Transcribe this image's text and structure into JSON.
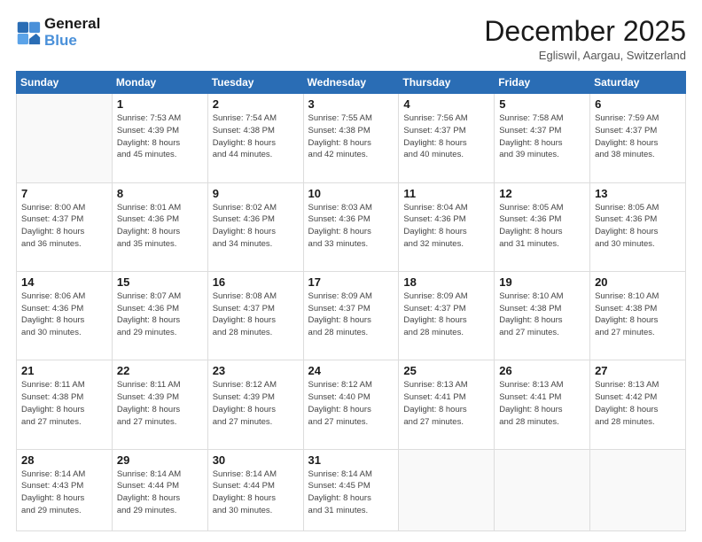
{
  "logo": {
    "line1": "General",
    "line2": "Blue"
  },
  "header": {
    "month": "December 2025",
    "location": "Egliswil, Aargau, Switzerland"
  },
  "weekdays": [
    "Sunday",
    "Monday",
    "Tuesday",
    "Wednesday",
    "Thursday",
    "Friday",
    "Saturday"
  ],
  "weeks": [
    [
      {
        "day": "",
        "sunrise": "",
        "sunset": "",
        "daylight": ""
      },
      {
        "day": "1",
        "sunrise": "Sunrise: 7:53 AM",
        "sunset": "Sunset: 4:39 PM",
        "daylight": "Daylight: 8 hours and 45 minutes."
      },
      {
        "day": "2",
        "sunrise": "Sunrise: 7:54 AM",
        "sunset": "Sunset: 4:38 PM",
        "daylight": "Daylight: 8 hours and 44 minutes."
      },
      {
        "day": "3",
        "sunrise": "Sunrise: 7:55 AM",
        "sunset": "Sunset: 4:38 PM",
        "daylight": "Daylight: 8 hours and 42 minutes."
      },
      {
        "day": "4",
        "sunrise": "Sunrise: 7:56 AM",
        "sunset": "Sunset: 4:37 PM",
        "daylight": "Daylight: 8 hours and 40 minutes."
      },
      {
        "day": "5",
        "sunrise": "Sunrise: 7:58 AM",
        "sunset": "Sunset: 4:37 PM",
        "daylight": "Daylight: 8 hours and 39 minutes."
      },
      {
        "day": "6",
        "sunrise": "Sunrise: 7:59 AM",
        "sunset": "Sunset: 4:37 PM",
        "daylight": "Daylight: 8 hours and 38 minutes."
      }
    ],
    [
      {
        "day": "7",
        "sunrise": "Sunrise: 8:00 AM",
        "sunset": "Sunset: 4:37 PM",
        "daylight": "Daylight: 8 hours and 36 minutes."
      },
      {
        "day": "8",
        "sunrise": "Sunrise: 8:01 AM",
        "sunset": "Sunset: 4:36 PM",
        "daylight": "Daylight: 8 hours and 35 minutes."
      },
      {
        "day": "9",
        "sunrise": "Sunrise: 8:02 AM",
        "sunset": "Sunset: 4:36 PM",
        "daylight": "Daylight: 8 hours and 34 minutes."
      },
      {
        "day": "10",
        "sunrise": "Sunrise: 8:03 AM",
        "sunset": "Sunset: 4:36 PM",
        "daylight": "Daylight: 8 hours and 33 minutes."
      },
      {
        "day": "11",
        "sunrise": "Sunrise: 8:04 AM",
        "sunset": "Sunset: 4:36 PM",
        "daylight": "Daylight: 8 hours and 32 minutes."
      },
      {
        "day": "12",
        "sunrise": "Sunrise: 8:05 AM",
        "sunset": "Sunset: 4:36 PM",
        "daylight": "Daylight: 8 hours and 31 minutes."
      },
      {
        "day": "13",
        "sunrise": "Sunrise: 8:05 AM",
        "sunset": "Sunset: 4:36 PM",
        "daylight": "Daylight: 8 hours and 30 minutes."
      }
    ],
    [
      {
        "day": "14",
        "sunrise": "Sunrise: 8:06 AM",
        "sunset": "Sunset: 4:36 PM",
        "daylight": "Daylight: 8 hours and 30 minutes."
      },
      {
        "day": "15",
        "sunrise": "Sunrise: 8:07 AM",
        "sunset": "Sunset: 4:36 PM",
        "daylight": "Daylight: 8 hours and 29 minutes."
      },
      {
        "day": "16",
        "sunrise": "Sunrise: 8:08 AM",
        "sunset": "Sunset: 4:37 PM",
        "daylight": "Daylight: 8 hours and 28 minutes."
      },
      {
        "day": "17",
        "sunrise": "Sunrise: 8:09 AM",
        "sunset": "Sunset: 4:37 PM",
        "daylight": "Daylight: 8 hours and 28 minutes."
      },
      {
        "day": "18",
        "sunrise": "Sunrise: 8:09 AM",
        "sunset": "Sunset: 4:37 PM",
        "daylight": "Daylight: 8 hours and 28 minutes."
      },
      {
        "day": "19",
        "sunrise": "Sunrise: 8:10 AM",
        "sunset": "Sunset: 4:38 PM",
        "daylight": "Daylight: 8 hours and 27 minutes."
      },
      {
        "day": "20",
        "sunrise": "Sunrise: 8:10 AM",
        "sunset": "Sunset: 4:38 PM",
        "daylight": "Daylight: 8 hours and 27 minutes."
      }
    ],
    [
      {
        "day": "21",
        "sunrise": "Sunrise: 8:11 AM",
        "sunset": "Sunset: 4:38 PM",
        "daylight": "Daylight: 8 hours and 27 minutes."
      },
      {
        "day": "22",
        "sunrise": "Sunrise: 8:11 AM",
        "sunset": "Sunset: 4:39 PM",
        "daylight": "Daylight: 8 hours and 27 minutes."
      },
      {
        "day": "23",
        "sunrise": "Sunrise: 8:12 AM",
        "sunset": "Sunset: 4:39 PM",
        "daylight": "Daylight: 8 hours and 27 minutes."
      },
      {
        "day": "24",
        "sunrise": "Sunrise: 8:12 AM",
        "sunset": "Sunset: 4:40 PM",
        "daylight": "Daylight: 8 hours and 27 minutes."
      },
      {
        "day": "25",
        "sunrise": "Sunrise: 8:13 AM",
        "sunset": "Sunset: 4:41 PM",
        "daylight": "Daylight: 8 hours and 27 minutes."
      },
      {
        "day": "26",
        "sunrise": "Sunrise: 8:13 AM",
        "sunset": "Sunset: 4:41 PM",
        "daylight": "Daylight: 8 hours and 28 minutes."
      },
      {
        "day": "27",
        "sunrise": "Sunrise: 8:13 AM",
        "sunset": "Sunset: 4:42 PM",
        "daylight": "Daylight: 8 hours and 28 minutes."
      }
    ],
    [
      {
        "day": "28",
        "sunrise": "Sunrise: 8:14 AM",
        "sunset": "Sunset: 4:43 PM",
        "daylight": "Daylight: 8 hours and 29 minutes."
      },
      {
        "day": "29",
        "sunrise": "Sunrise: 8:14 AM",
        "sunset": "Sunset: 4:44 PM",
        "daylight": "Daylight: 8 hours and 29 minutes."
      },
      {
        "day": "30",
        "sunrise": "Sunrise: 8:14 AM",
        "sunset": "Sunset: 4:44 PM",
        "daylight": "Daylight: 8 hours and 30 minutes."
      },
      {
        "day": "31",
        "sunrise": "Sunrise: 8:14 AM",
        "sunset": "Sunset: 4:45 PM",
        "daylight": "Daylight: 8 hours and 31 minutes."
      },
      {
        "day": "",
        "sunrise": "",
        "sunset": "",
        "daylight": ""
      },
      {
        "day": "",
        "sunrise": "",
        "sunset": "",
        "daylight": ""
      },
      {
        "day": "",
        "sunrise": "",
        "sunset": "",
        "daylight": ""
      }
    ]
  ]
}
